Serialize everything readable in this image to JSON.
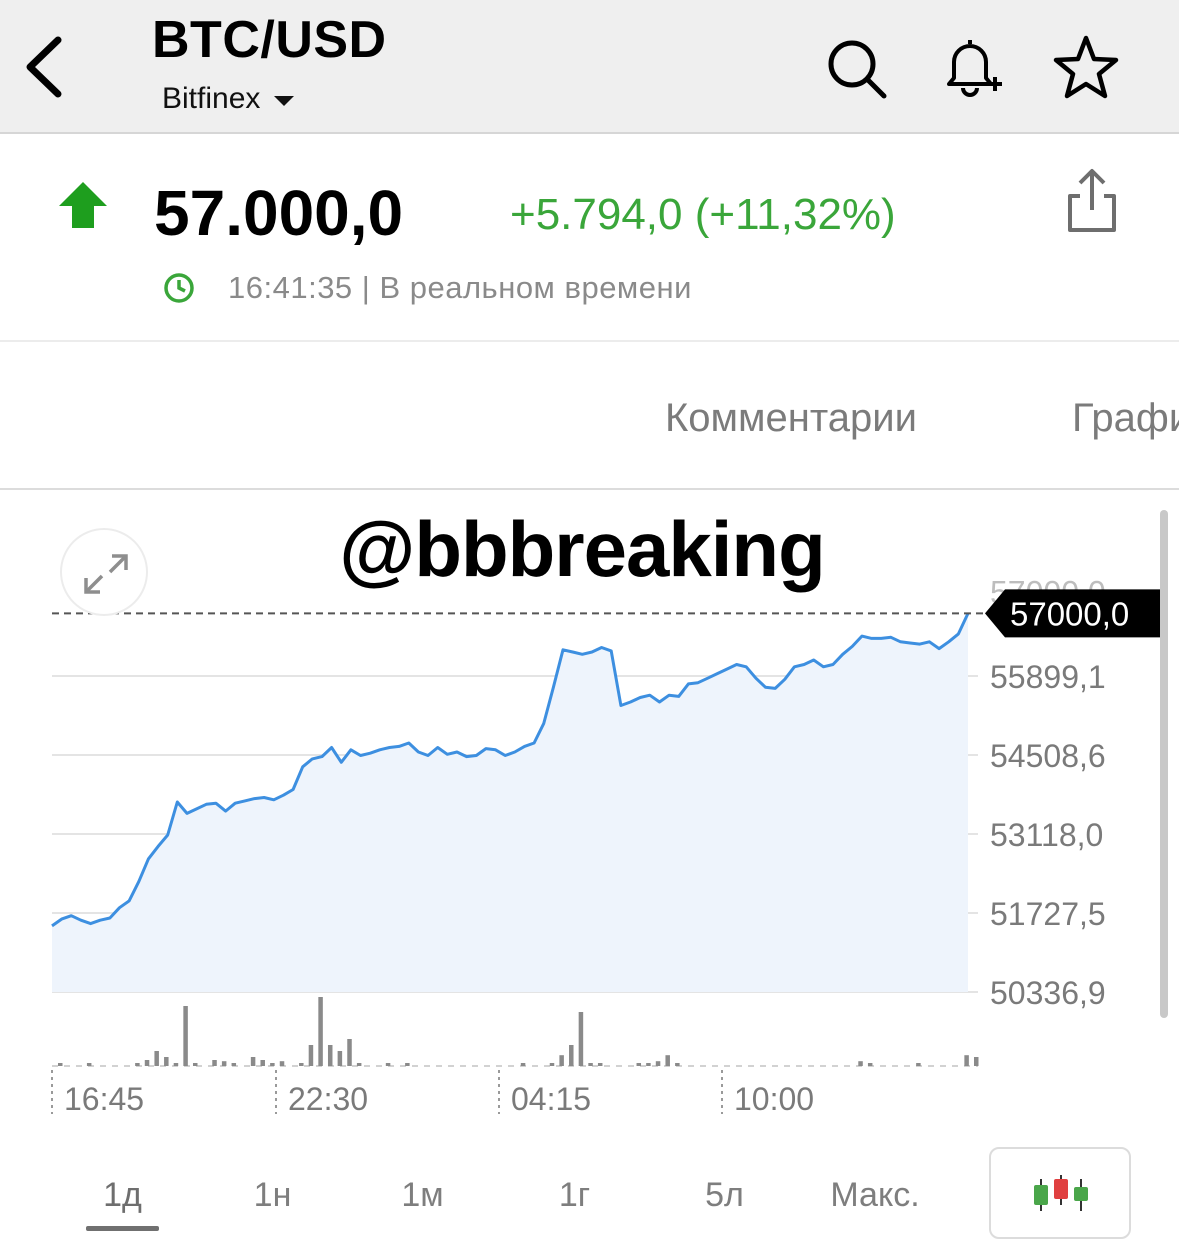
{
  "header": {
    "title": "BTC/USD",
    "exchange": "Bitfinex",
    "icons": [
      "back-chevron-icon",
      "search-icon",
      "bell-plus-icon",
      "star-icon"
    ]
  },
  "quote": {
    "price": "57.000,0",
    "change": "+5.794,0 (+11,32%)",
    "time_status": "16:41:35 | В реальном времени",
    "direction": "up",
    "up_color": "#2aa02a",
    "change_color": "#3aa63a"
  },
  "tabs": {
    "comments": "Комментарии",
    "graph": "График"
  },
  "watermark": "@bbbreaking",
  "chart_data": {
    "type": "area",
    "y_ticks": [
      "55899,1",
      "54508,6",
      "53118,0",
      "51727,5",
      "50336,9"
    ],
    "y_tick_partial_top": "57000,0",
    "current_price_label": "57000,0",
    "x_ticks": [
      "16:45",
      "22:30",
      "04:15",
      "10:00"
    ],
    "ylim": [
      50336.9,
      57060.0
    ],
    "line_color": "#3d8fe0",
    "values": [
      51500,
      51620,
      51680,
      51600,
      51540,
      51600,
      51640,
      51820,
      51940,
      52280,
      52680,
      52900,
      53100,
      53680,
      53480,
      53560,
      53640,
      53660,
      53520,
      53660,
      53700,
      53740,
      53760,
      53720,
      53800,
      53900,
      54300,
      54440,
      54480,
      54640,
      54380,
      54600,
      54500,
      54540,
      54600,
      54640,
      54660,
      54720,
      54560,
      54500,
      54640,
      54520,
      54560,
      54480,
      54500,
      54620,
      54600,
      54500,
      54560,
      54660,
      54720,
      55060,
      55700,
      56360,
      56320,
      56280,
      56320,
      56400,
      56340,
      55380,
      55440,
      55520,
      55560,
      55440,
      55560,
      55540,
      55760,
      55780,
      55860,
      55940,
      56020,
      56100,
      56060,
      55860,
      55700,
      55680,
      55840,
      56060,
      56100,
      56180,
      56060,
      56100,
      56280,
      56420,
      56600,
      56560,
      56560,
      56580,
      56500,
      56480,
      56460,
      56500,
      56380,
      56500,
      56640,
      57000
    ],
    "volumes": [
      0.02,
      0,
      0,
      0.02,
      0,
      0,
      0,
      0,
      0.05,
      0.1,
      0.25,
      0.15,
      0.02,
      1.0,
      0.05,
      0,
      0.1,
      0.08,
      0.03,
      0,
      0.15,
      0.1,
      0.05,
      0.08,
      0,
      0.05,
      0.35,
      1.15,
      0.35,
      0.25,
      0.45,
      0.05,
      0,
      0,
      0.02,
      0,
      0.03,
      0,
      0,
      0,
      0,
      0,
      0,
      0,
      0,
      0,
      0,
      0,
      0.03,
      0,
      0,
      0.02,
      0.18,
      0.35,
      0.9,
      0.05,
      0.02,
      0,
      0,
      0,
      0.02,
      0.05,
      0.08,
      0.18,
      0.04,
      0,
      0,
      0,
      0,
      0,
      0,
      0,
      0,
      0,
      0,
      0,
      0,
      0,
      0,
      0,
      0,
      0,
      0,
      0.08,
      0.03,
      0,
      0,
      0,
      0,
      0.05,
      0,
      0,
      0,
      0,
      0.18,
      0.15
    ],
    "grid": true
  },
  "periods": [
    "1д",
    "1н",
    "1м",
    "1г",
    "5л",
    "Макс."
  ],
  "active_period": "1д",
  "candle_colors": [
    "#4aa64a",
    "#e04040",
    "#4aa64a"
  ]
}
